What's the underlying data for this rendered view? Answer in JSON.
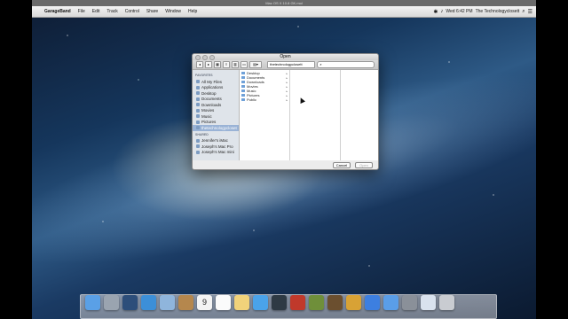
{
  "window_caption": "Mac OS X 10.8 GK.mol",
  "menubar": {
    "app_name": "GarageBand",
    "items": [
      "File",
      "Edit",
      "Track",
      "Control",
      "Share",
      "Window",
      "Help"
    ],
    "clock": "Wed 6:42 PM",
    "user": "The Technologyclosett"
  },
  "dialog": {
    "title": "Open",
    "location": "thetechnologyclosett",
    "search_placeholder": "",
    "sidebar": {
      "favorites_header": "FAVORITES",
      "favorites": [
        "All My Files",
        "Applications",
        "Desktop",
        "Documents",
        "Downloads",
        "Movies",
        "Music",
        "Pictures",
        "thetechnologycloset"
      ],
      "shared_header": "SHARED",
      "shared": [
        "Jennifer's iMac",
        "Joseph's Mac Pro",
        "Joseph's Mac mini"
      ]
    },
    "column1": [
      "Desktop",
      "Documents",
      "Downloads",
      "Movies",
      "Music",
      "Pictures",
      "Public"
    ],
    "cancel_label": "Cancel",
    "open_label": "Open"
  },
  "dock": {
    "calendar_day": "9",
    "icons": [
      "finder-icon",
      "launchpad-icon",
      "mission-control-icon",
      "safari-icon",
      "mail-icon",
      "contacts-icon",
      "calendar-icon",
      "reminders-icon",
      "notes-icon",
      "messages-icon",
      "facetime-icon",
      "photo-booth-icon",
      "iphoto-icon",
      "imovie-icon",
      "garageband-icon",
      "itunes-icon",
      "app-store-icon",
      "system-preferences-icon",
      "documents-icon",
      "trash-icon"
    ]
  }
}
